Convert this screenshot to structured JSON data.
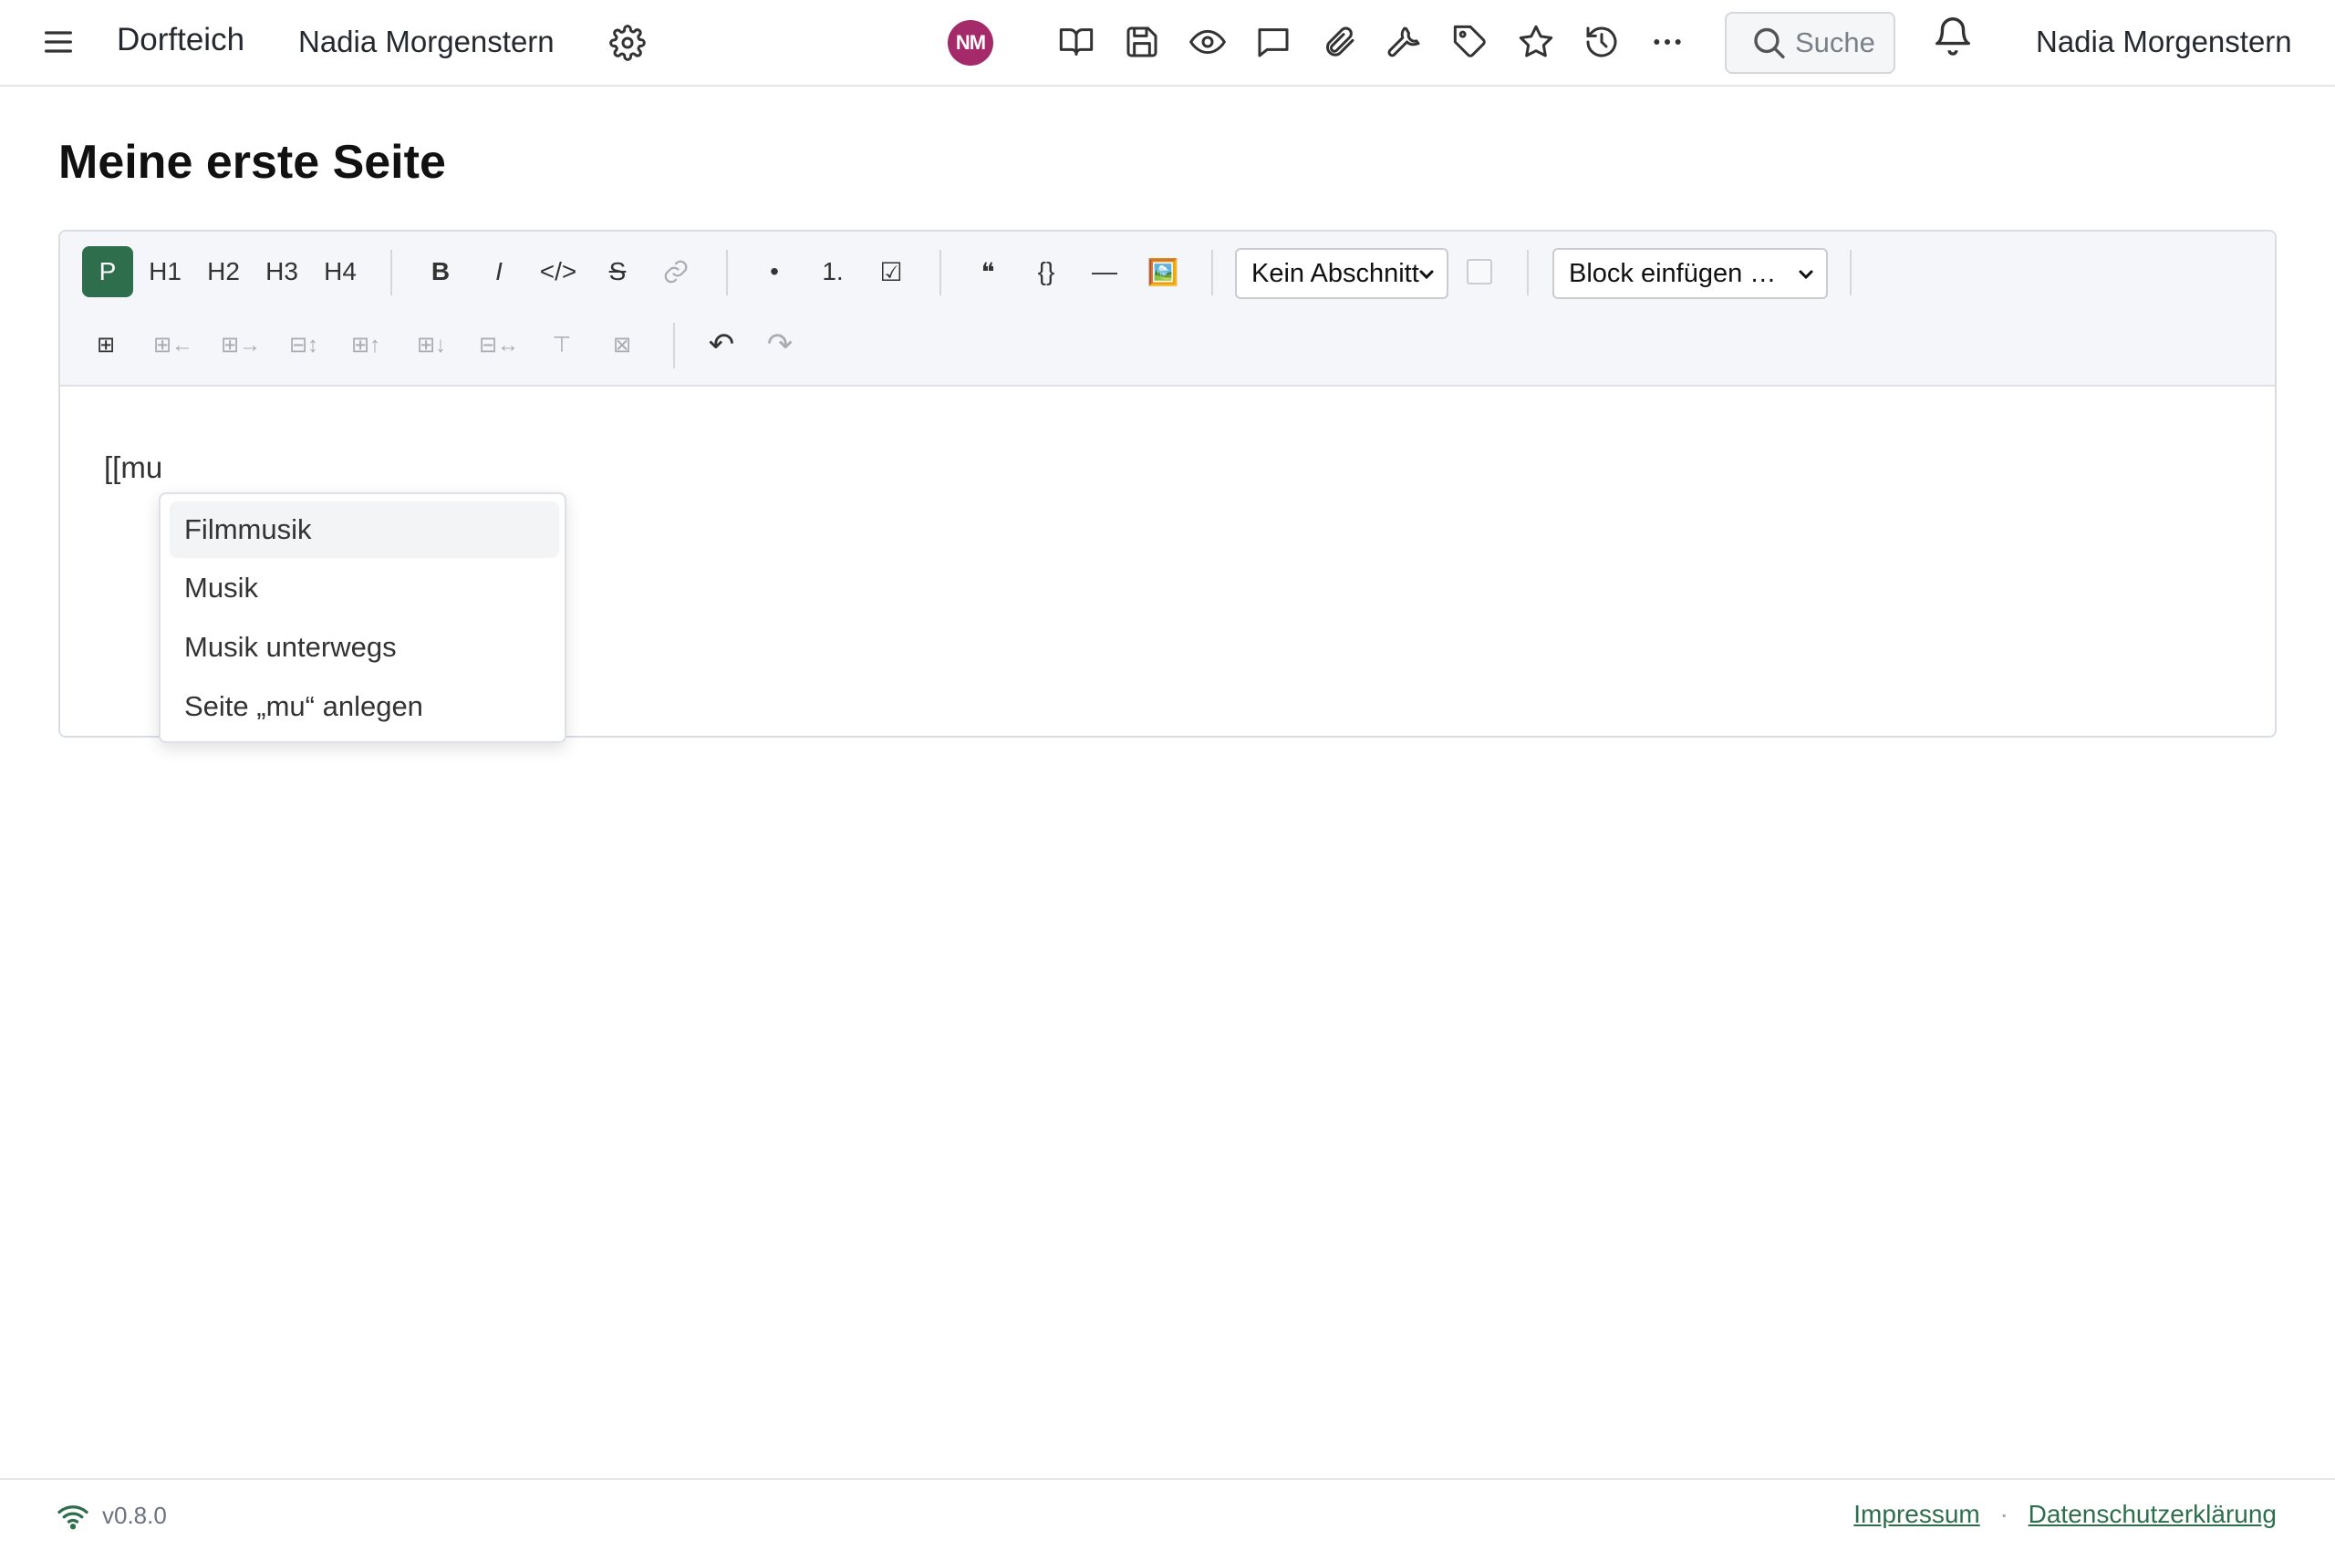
{
  "header": {
    "wiki_name": "Dorfteich",
    "user_link": "Nadia Morgenstern",
    "avatar_initials": "NM",
    "avatar_color": "#a52a6a",
    "search_placeholder": "Suche",
    "user_name_right": "Nadia Morgenstern",
    "tool_icons": [
      "book-icon",
      "save-icon",
      "eye-icon",
      "comment-icon",
      "paperclip-icon",
      "wrench-icon",
      "tag-icon",
      "star-icon",
      "history-icon",
      "more-icon"
    ]
  },
  "page": {
    "title": "Meine erste Seite"
  },
  "toolbar": {
    "paragraph": "P",
    "h1": "H1",
    "h2": "H2",
    "h3": "H3",
    "h4": "H4",
    "bold": "B",
    "italic": "I",
    "code": "</>",
    "strike": "S",
    "bullet": "•",
    "ordered": "1.",
    "checklist": "☑",
    "quote": "❝",
    "codeblock": "{}",
    "hr": "—",
    "image": "🖼️",
    "section_select": "Kein Abschnitt",
    "block_select": "Block einfügen …",
    "table_tools": [
      "⊞",
      "⊞←",
      "⊞→",
      "⊟↕",
      "⊞↑",
      "⊞↓",
      "⊟↔",
      "⊤",
      "⊠"
    ],
    "undo": "↶",
    "redo": "↷",
    "accent_color": "#2f6e4c"
  },
  "editor": {
    "typed_text": "[[mu"
  },
  "autocomplete": {
    "items": [
      "Filmmusik",
      "Musik",
      "Musik unterwegs",
      "Seite „mu“ anlegen"
    ]
  },
  "footer": {
    "version": "v0.8.0",
    "imprint": "Impressum",
    "separator": "·",
    "privacy": "Datenschutzerklärung"
  }
}
